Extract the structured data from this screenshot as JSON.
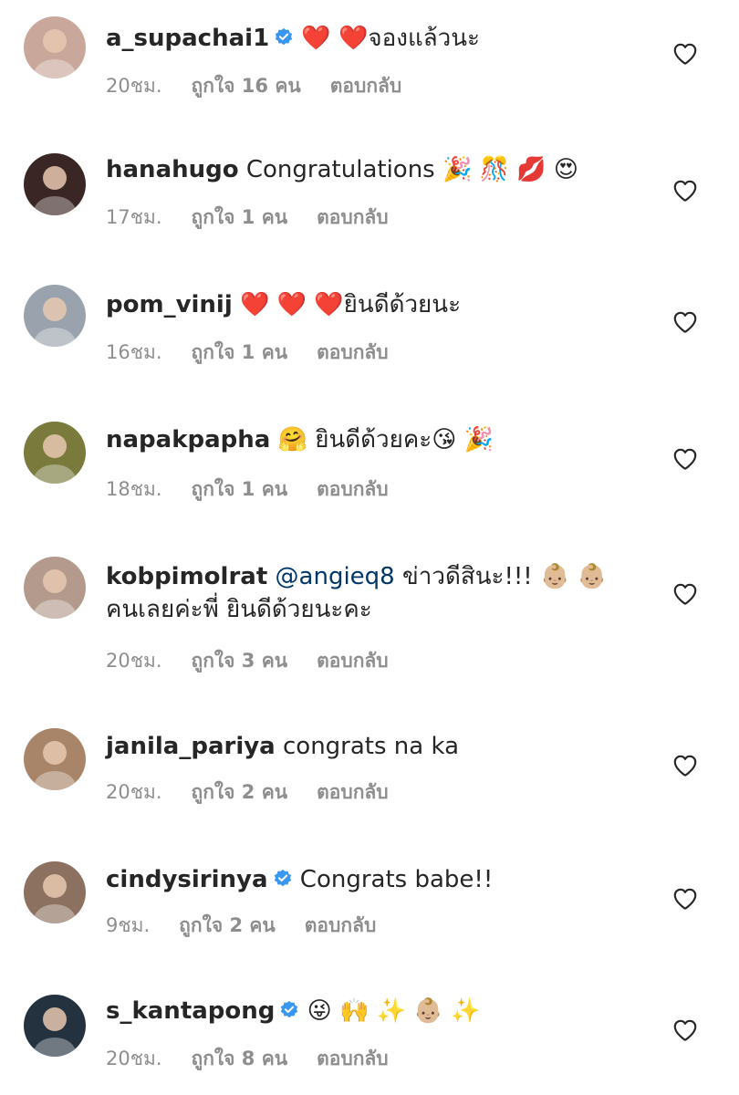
{
  "comments": [
    {
      "username": "a_supachai1",
      "verified": true,
      "text": "❤️ ❤️จองแล้วนะ",
      "time": "20ชม.",
      "likes": "ถูกใจ 16 คน",
      "reply": "ตอบกลับ",
      "avatar_color": "#c9a79a"
    },
    {
      "username": "hanahugo",
      "verified": false,
      "text": "Congratulations 🎉 🎊 💋 😍",
      "time": "17ชม.",
      "likes": "ถูกใจ 1 คน",
      "reply": "ตอบกลับ",
      "avatar_color": "#3a2624"
    },
    {
      "username": "pom_vinij",
      "verified": false,
      "text": "❤️ ❤️ ❤️ยินดีด้วยนะ",
      "time": "16ชม.",
      "likes": "ถูกใจ 1 คน",
      "reply": "ตอบกลับ",
      "avatar_color": "#9aa3ad"
    },
    {
      "username": "napakpapha",
      "verified": false,
      "text": "🤗 ยินดีด้วยคะ😘 🎉",
      "time": "18ชม.",
      "likes": "ถูกใจ 1 คน",
      "reply": "ตอบกลับ",
      "avatar_color": "#7a7a3c"
    },
    {
      "username": "kobpimolrat",
      "verified": false,
      "mention": "@angieq8",
      "text": "ข่าวดีสินะ!!! 👶🏼 👶🏼",
      "text_line2": "คนเลยค่ะพี่ ยินดีด้วยนะคะ",
      "time": "20ชม.",
      "likes": "ถูกใจ 3 คน",
      "reply": "ตอบกลับ",
      "avatar_color": "#b49a8c"
    },
    {
      "username": "janila_pariya",
      "verified": false,
      "text": "congrats na ka",
      "time": "20ชม.",
      "likes": "ถูกใจ 2 คน",
      "reply": "ตอบกลับ",
      "avatar_color": "#a88468"
    },
    {
      "username": "cindysirinya",
      "verified": true,
      "text": "Congrats babe!!",
      "time": "9ชม.",
      "likes": "ถูกใจ 2 คน",
      "reply": "ตอบกลับ",
      "avatar_color": "#8c7060"
    },
    {
      "username": "s_kantapong",
      "verified": true,
      "text": "😜 🙌 ✨ 👶🏼 ✨",
      "time": "20ชม.",
      "likes": "ถูกใจ 8 คน",
      "reply": "ตอบกลับ",
      "avatar_color": "#24323f"
    }
  ],
  "colors": {
    "verified_blue": "#3897f0",
    "meta_gray": "#8e8e8e",
    "mention_blue": "#00376b"
  },
  "icons": {
    "like": "heart-outline-icon",
    "verified": "verified-badge-icon"
  }
}
